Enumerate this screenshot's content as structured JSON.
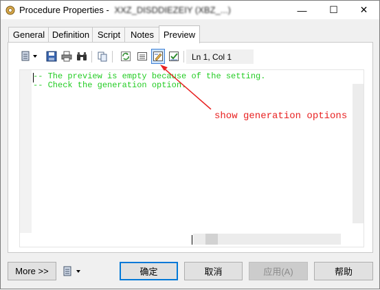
{
  "window": {
    "title": "Procedure Properties - ",
    "title_obscured": "XXZ_DISDDIEZEIY (XBZ_...)",
    "minimize": "—",
    "maximize": "☐",
    "close": "✕"
  },
  "tabs": [
    {
      "label": "General"
    },
    {
      "label": "Definition"
    },
    {
      "label": "Script"
    },
    {
      "label": "Notes"
    },
    {
      "label": "Preview"
    }
  ],
  "toolbar": {
    "position_label": "Ln 1, Col 1"
  },
  "editor": {
    "line1": "-- The preview is empty because of the setting.",
    "line2": "-- Check the generation option."
  },
  "annotation": {
    "text": "show generation options",
    "color": "#e82020"
  },
  "buttons": {
    "more": "More >>",
    "ok": "确定",
    "cancel": "取消",
    "apply": "应用(A)",
    "help": "帮助"
  }
}
